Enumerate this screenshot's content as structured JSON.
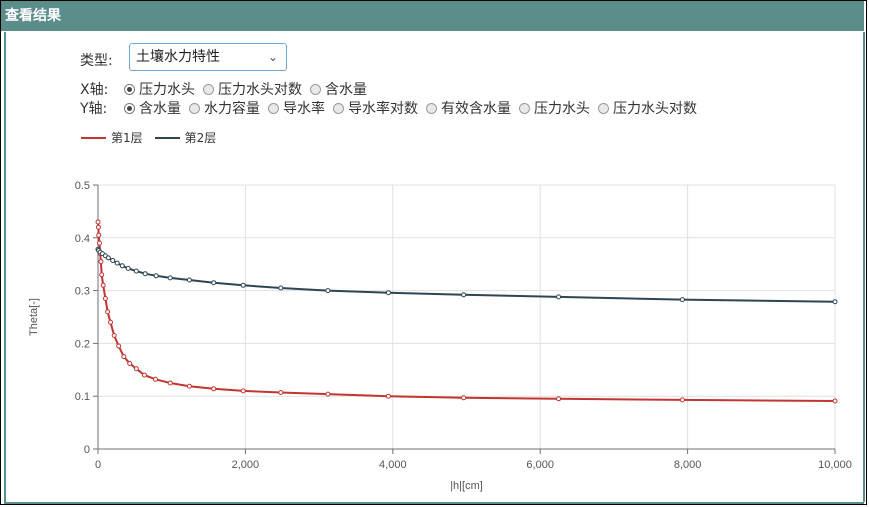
{
  "window": {
    "title": "查看结果"
  },
  "type_selector": {
    "label": "类型:",
    "value": "土壤水力特性"
  },
  "x_axis_selector": {
    "label": "X轴:",
    "options": [
      {
        "label": "压力水头",
        "selected": true
      },
      {
        "label": "压力水头对数",
        "selected": false
      },
      {
        "label": "含水量",
        "selected": false
      }
    ]
  },
  "y_axis_selector": {
    "label": "Y轴:",
    "options": [
      {
        "label": "含水量",
        "selected": true
      },
      {
        "label": "水力容量",
        "selected": false
      },
      {
        "label": "导水率",
        "selected": false
      },
      {
        "label": "导水率对数",
        "selected": false
      },
      {
        "label": "有效含水量",
        "selected": false
      },
      {
        "label": "压力水头",
        "selected": false
      },
      {
        "label": "压力水头对数",
        "selected": false
      }
    ]
  },
  "colors": {
    "series1": "#c23531",
    "series2": "#2f4554",
    "header": "#5b8d8b"
  },
  "chart_data": {
    "type": "line",
    "xlabel": "|h|[cm]",
    "ylabel": "Theta[-]",
    "xlim": [
      0,
      10000
    ],
    "ylim": [
      0,
      0.5
    ],
    "x_ticks": [
      "0",
      "2,000",
      "4,000",
      "6,000",
      "8,000",
      "10,000"
    ],
    "y_ticks": [
      "0",
      "0.1",
      "0.2",
      "0.3",
      "0.4",
      "0.5"
    ],
    "grid": true,
    "legend": "top-left",
    "series": [
      {
        "name": "第1层",
        "color": "#c23531",
        "points": [
          [
            0,
            0.43
          ],
          [
            5,
            0.42
          ],
          [
            10,
            0.405
          ],
          [
            20,
            0.39
          ],
          [
            30,
            0.37
          ],
          [
            40,
            0.355
          ],
          [
            50,
            0.33
          ],
          [
            70,
            0.31
          ],
          [
            100,
            0.285
          ],
          [
            130,
            0.26
          ],
          [
            170,
            0.24
          ],
          [
            220,
            0.215
          ],
          [
            280,
            0.195
          ],
          [
            350,
            0.175
          ],
          [
            430,
            0.162
          ],
          [
            520,
            0.152
          ],
          [
            630,
            0.14
          ],
          [
            780,
            0.132
          ],
          [
            980,
            0.125
          ],
          [
            1240,
            0.119
          ],
          [
            1570,
            0.114
          ],
          [
            1970,
            0.11
          ],
          [
            2480,
            0.107
          ],
          [
            3120,
            0.104
          ],
          [
            3940,
            0.1
          ],
          [
            4960,
            0.097
          ],
          [
            6250,
            0.095
          ],
          [
            7930,
            0.093
          ],
          [
            10000,
            0.091
          ]
        ]
      },
      {
        "name": "第2层",
        "color": "#2f4554",
        "points": [
          [
            0,
            0.378
          ],
          [
            10,
            0.376
          ],
          [
            30,
            0.373
          ],
          [
            60,
            0.37
          ],
          [
            100,
            0.366
          ],
          [
            140,
            0.362
          ],
          [
            200,
            0.357
          ],
          [
            260,
            0.352
          ],
          [
            330,
            0.347
          ],
          [
            410,
            0.342
          ],
          [
            520,
            0.337
          ],
          [
            640,
            0.332
          ],
          [
            790,
            0.328
          ],
          [
            980,
            0.324
          ],
          [
            1240,
            0.32
          ],
          [
            1570,
            0.315
          ],
          [
            1970,
            0.31
          ],
          [
            2480,
            0.305
          ],
          [
            3120,
            0.3
          ],
          [
            3940,
            0.296
          ],
          [
            4960,
            0.292
          ],
          [
            6250,
            0.288
          ],
          [
            7930,
            0.283
          ],
          [
            10000,
            0.279
          ]
        ]
      }
    ]
  }
}
